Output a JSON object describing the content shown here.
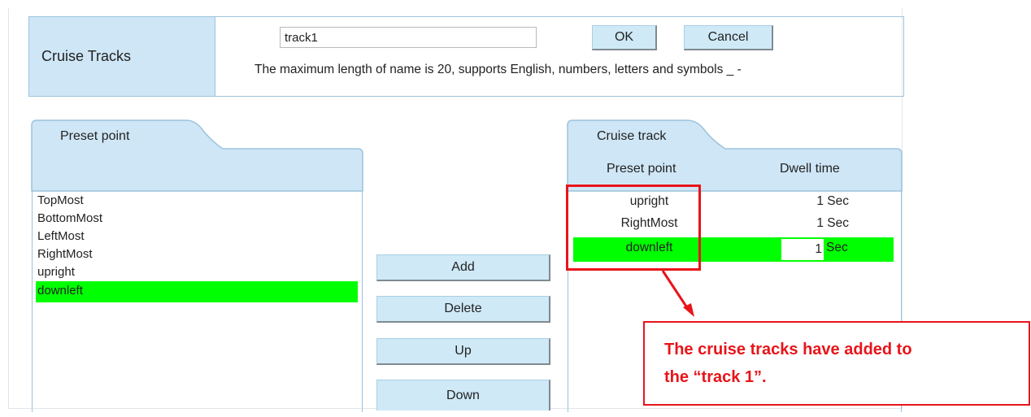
{
  "cruise": {
    "label": "Cruise Tracks",
    "name_value": "track1",
    "ok_label": "OK",
    "cancel_label": "Cancel",
    "hint": "The maximum length of name is 20, supports English, numbers, letters and symbols _ -"
  },
  "preset_panel": {
    "tab": "Preset point",
    "items": [
      "TopMost",
      "BottomMost",
      "LeftMost",
      "RightMost",
      "upright",
      "downleft"
    ],
    "selected": "downleft"
  },
  "buttons": {
    "add": "Add",
    "delete": "Delete",
    "up": "Up",
    "down": "Down"
  },
  "track_panel": {
    "tab": "Cruise track",
    "col_preset": "Preset point",
    "col_dwell": "Dwell time",
    "rows": [
      {
        "point": "upright",
        "dwell": "1 Sec"
      },
      {
        "point": "RightMost",
        "dwell": "1 Sec"
      },
      {
        "point": "downleft",
        "dwell_value": "1",
        "dwell_unit": "Sec"
      }
    ]
  },
  "callout": {
    "line1": "The cruise tracks have added to",
    "line2": "the “track 1”."
  },
  "colors": {
    "header_blue": "#cfe6f6",
    "highlight_green": "#00ff00",
    "annotation_red": "#e8141a"
  }
}
